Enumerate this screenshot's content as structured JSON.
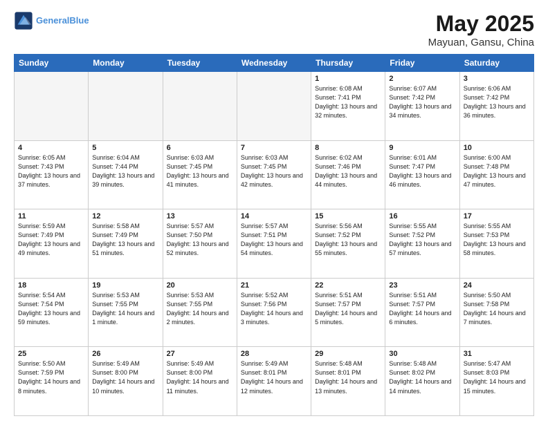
{
  "header": {
    "logo_line1": "General",
    "logo_line2": "Blue",
    "title": "May 2025",
    "subtitle": "Mayuan, Gansu, China"
  },
  "weekdays": [
    "Sunday",
    "Monday",
    "Tuesday",
    "Wednesday",
    "Thursday",
    "Friday",
    "Saturday"
  ],
  "weeks": [
    [
      {
        "day": "",
        "empty": true
      },
      {
        "day": "",
        "empty": true
      },
      {
        "day": "",
        "empty": true
      },
      {
        "day": "",
        "empty": true
      },
      {
        "day": "1",
        "sunrise": "6:08 AM",
        "sunset": "7:41 PM",
        "daylight": "13 hours and 32 minutes."
      },
      {
        "day": "2",
        "sunrise": "6:07 AM",
        "sunset": "7:42 PM",
        "daylight": "13 hours and 34 minutes."
      },
      {
        "day": "3",
        "sunrise": "6:06 AM",
        "sunset": "7:42 PM",
        "daylight": "13 hours and 36 minutes."
      }
    ],
    [
      {
        "day": "4",
        "sunrise": "6:05 AM",
        "sunset": "7:43 PM",
        "daylight": "13 hours and 37 minutes."
      },
      {
        "day": "5",
        "sunrise": "6:04 AM",
        "sunset": "7:44 PM",
        "daylight": "13 hours and 39 minutes."
      },
      {
        "day": "6",
        "sunrise": "6:03 AM",
        "sunset": "7:45 PM",
        "daylight": "13 hours and 41 minutes."
      },
      {
        "day": "7",
        "sunrise": "6:03 AM",
        "sunset": "7:45 PM",
        "daylight": "13 hours and 42 minutes."
      },
      {
        "day": "8",
        "sunrise": "6:02 AM",
        "sunset": "7:46 PM",
        "daylight": "13 hours and 44 minutes."
      },
      {
        "day": "9",
        "sunrise": "6:01 AM",
        "sunset": "7:47 PM",
        "daylight": "13 hours and 46 minutes."
      },
      {
        "day": "10",
        "sunrise": "6:00 AM",
        "sunset": "7:48 PM",
        "daylight": "13 hours and 47 minutes."
      }
    ],
    [
      {
        "day": "11",
        "sunrise": "5:59 AM",
        "sunset": "7:49 PM",
        "daylight": "13 hours and 49 minutes."
      },
      {
        "day": "12",
        "sunrise": "5:58 AM",
        "sunset": "7:49 PM",
        "daylight": "13 hours and 51 minutes."
      },
      {
        "day": "13",
        "sunrise": "5:57 AM",
        "sunset": "7:50 PM",
        "daylight": "13 hours and 52 minutes."
      },
      {
        "day": "14",
        "sunrise": "5:57 AM",
        "sunset": "7:51 PM",
        "daylight": "13 hours and 54 minutes."
      },
      {
        "day": "15",
        "sunrise": "5:56 AM",
        "sunset": "7:52 PM",
        "daylight": "13 hours and 55 minutes."
      },
      {
        "day": "16",
        "sunrise": "5:55 AM",
        "sunset": "7:52 PM",
        "daylight": "13 hours and 57 minutes."
      },
      {
        "day": "17",
        "sunrise": "5:55 AM",
        "sunset": "7:53 PM",
        "daylight": "13 hours and 58 minutes."
      }
    ],
    [
      {
        "day": "18",
        "sunrise": "5:54 AM",
        "sunset": "7:54 PM",
        "daylight": "13 hours and 59 minutes."
      },
      {
        "day": "19",
        "sunrise": "5:53 AM",
        "sunset": "7:55 PM",
        "daylight": "14 hours and 1 minute."
      },
      {
        "day": "20",
        "sunrise": "5:53 AM",
        "sunset": "7:55 PM",
        "daylight": "14 hours and 2 minutes."
      },
      {
        "day": "21",
        "sunrise": "5:52 AM",
        "sunset": "7:56 PM",
        "daylight": "14 hours and 3 minutes."
      },
      {
        "day": "22",
        "sunrise": "5:51 AM",
        "sunset": "7:57 PM",
        "daylight": "14 hours and 5 minutes."
      },
      {
        "day": "23",
        "sunrise": "5:51 AM",
        "sunset": "7:57 PM",
        "daylight": "14 hours and 6 minutes."
      },
      {
        "day": "24",
        "sunrise": "5:50 AM",
        "sunset": "7:58 PM",
        "daylight": "14 hours and 7 minutes."
      }
    ],
    [
      {
        "day": "25",
        "sunrise": "5:50 AM",
        "sunset": "7:59 PM",
        "daylight": "14 hours and 8 minutes."
      },
      {
        "day": "26",
        "sunrise": "5:49 AM",
        "sunset": "8:00 PM",
        "daylight": "14 hours and 10 minutes."
      },
      {
        "day": "27",
        "sunrise": "5:49 AM",
        "sunset": "8:00 PM",
        "daylight": "14 hours and 11 minutes."
      },
      {
        "day": "28",
        "sunrise": "5:49 AM",
        "sunset": "8:01 PM",
        "daylight": "14 hours and 12 minutes."
      },
      {
        "day": "29",
        "sunrise": "5:48 AM",
        "sunset": "8:01 PM",
        "daylight": "14 hours and 13 minutes."
      },
      {
        "day": "30",
        "sunrise": "5:48 AM",
        "sunset": "8:02 PM",
        "daylight": "14 hours and 14 minutes."
      },
      {
        "day": "31",
        "sunrise": "5:47 AM",
        "sunset": "8:03 PM",
        "daylight": "14 hours and 15 minutes."
      }
    ]
  ]
}
